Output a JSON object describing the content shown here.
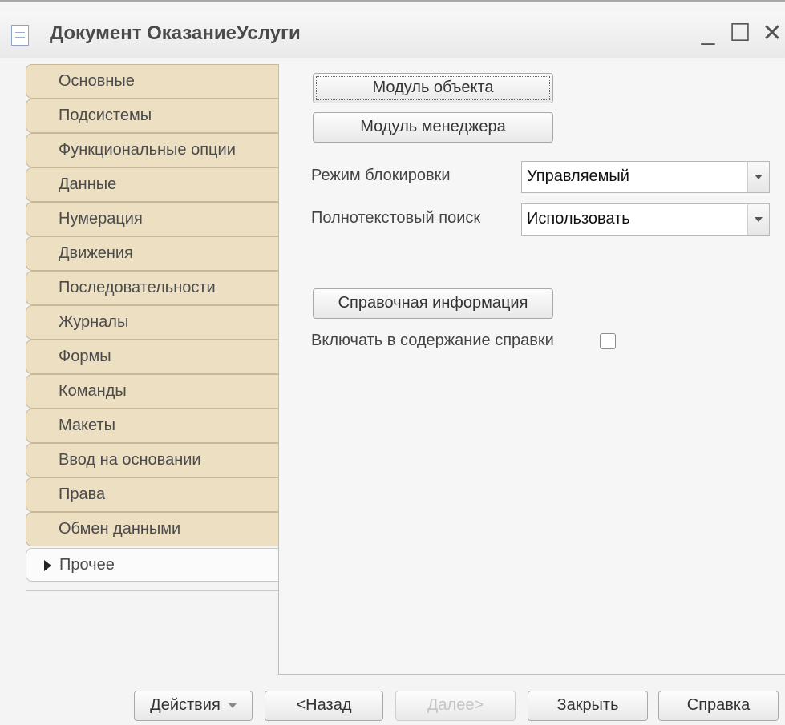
{
  "window": {
    "title": "Документ ОказаниеУслуги",
    "controls": {
      "minimize": "_",
      "maximize": "☐",
      "close": "✕"
    }
  },
  "tabs": {
    "items": [
      {
        "label": "Основные"
      },
      {
        "label": "Подсистемы"
      },
      {
        "label": "Функциональные опции"
      },
      {
        "label": "Данные"
      },
      {
        "label": "Нумерация"
      },
      {
        "label": "Движения"
      },
      {
        "label": "Последовательности"
      },
      {
        "label": "Журналы"
      },
      {
        "label": "Формы"
      },
      {
        "label": "Команды"
      },
      {
        "label": "Макеты"
      },
      {
        "label": "Ввод на основании"
      },
      {
        "label": "Права"
      },
      {
        "label": "Обмен данными"
      },
      {
        "label": "Прочее"
      }
    ],
    "active": "Прочее"
  },
  "panel": {
    "object_module_button": "Модуль объекта",
    "manager_module_button": "Модуль менеджера",
    "lock_mode": {
      "label": "Режим блокировки",
      "value": "Управляемый"
    },
    "fulltext_search": {
      "label": "Полнотекстовый поиск",
      "value": "Использовать"
    },
    "help_info_button": "Справочная информация",
    "include_in_help": {
      "label": "Включать в содержание справки",
      "checked": false
    }
  },
  "footer": {
    "actions_button": "Действия",
    "back_button": "<Назад",
    "next_button": "Далее>",
    "close_button": "Закрыть",
    "help_button": "Справка"
  }
}
